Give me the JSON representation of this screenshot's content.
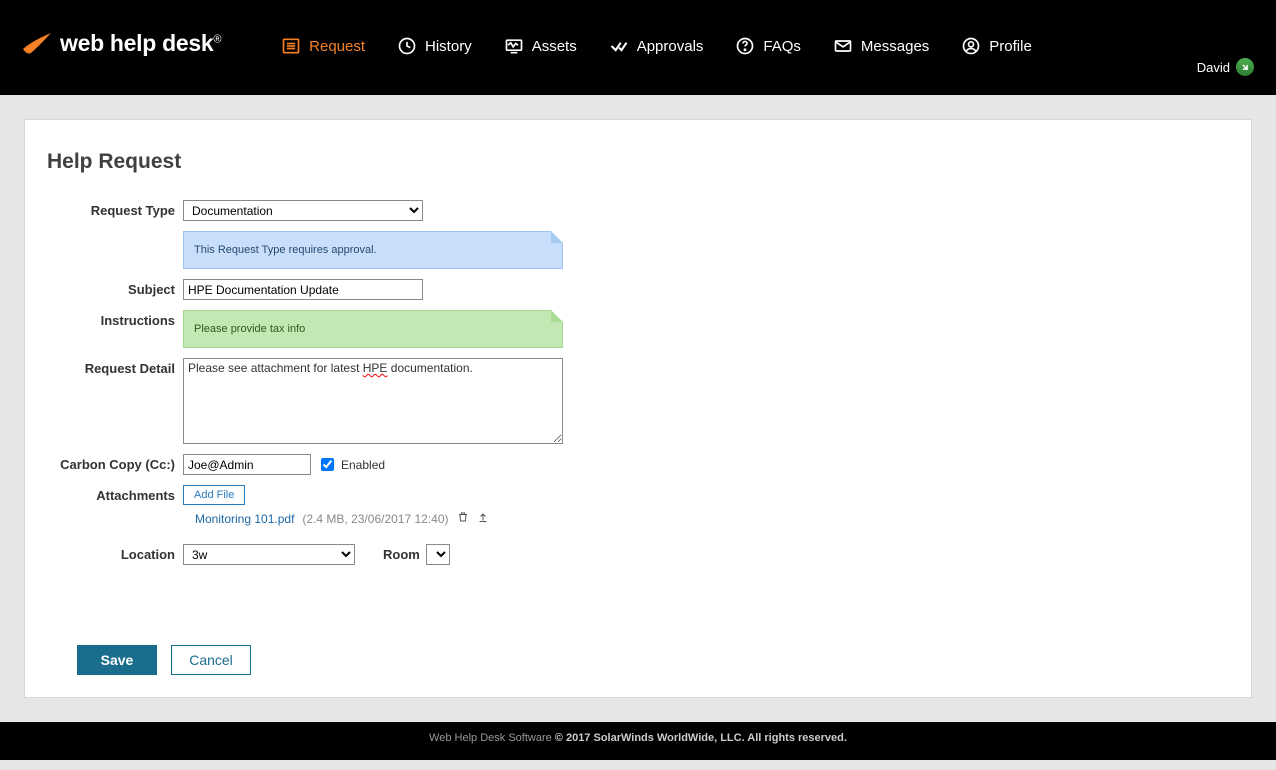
{
  "brand": {
    "name": "web help desk"
  },
  "nav": {
    "items": [
      {
        "label": "Request",
        "icon": "list-icon",
        "active": true
      },
      {
        "label": "History",
        "icon": "clock-icon"
      },
      {
        "label": "Assets",
        "icon": "monitor-icon"
      },
      {
        "label": "Approvals",
        "icon": "check-icon"
      },
      {
        "label": "FAQs",
        "icon": "question-icon"
      },
      {
        "label": "Messages",
        "icon": "mail-icon"
      },
      {
        "label": "Profile",
        "icon": "user-icon"
      }
    ]
  },
  "user": {
    "name": "David"
  },
  "page": {
    "title": "Help Request"
  },
  "form": {
    "request_type": {
      "label": "Request Type",
      "value": "Documentation"
    },
    "approval_note": "This Request Type requires approval.",
    "subject": {
      "label": "Subject",
      "value": "HPE Documentation Update"
    },
    "instructions": {
      "label": "Instructions",
      "note": "Please provide tax info"
    },
    "detail": {
      "label": "Request Detail",
      "prefix": "Please see attachment for latest ",
      "spell": "HPE",
      "suffix": " documentation."
    },
    "cc": {
      "label": "Carbon Copy (Cc:)",
      "value": "Joe@Admin",
      "enabled_label": "Enabled",
      "enabled": true
    },
    "attachments": {
      "label": "Attachments",
      "add_label": "Add File",
      "file_name": "Monitoring 101.pdf",
      "file_meta": "(2.4 MB, 23/06/2017 12:40)"
    },
    "location": {
      "label": "Location",
      "value": "3w"
    },
    "room": {
      "label": "Room",
      "value": ""
    }
  },
  "buttons": {
    "save": "Save",
    "cancel": "Cancel"
  },
  "footer": {
    "prefix": "Web Help Desk Software ",
    "bold": "© 2017 SolarWinds WorldWide, LLC. All rights reserved."
  }
}
